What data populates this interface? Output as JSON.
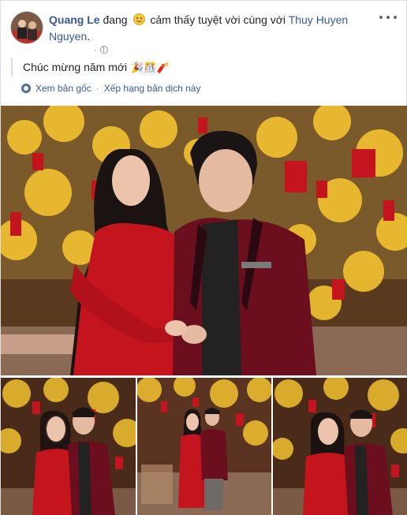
{
  "post": {
    "author": "Quang Le",
    "feeling_prefix": "đang",
    "feeling_icon": "smile-emoji",
    "feeling_text": "cảm thấy tuyệt vời cùng với",
    "tagged_user": "Thuy Huyen Nguyen",
    "tagged_suffix": ".",
    "timestamp": "·",
    "privacy_icon": "globe-icon",
    "status_text": "Chúc mừng năm mới",
    "status_emojis": "🎉🎊🧨",
    "see_original": "Xem bản gốc",
    "separator": "·",
    "rate_translation": "Xếp hạng bản dịch này"
  },
  "photos": [
    {
      "label": "photo-main",
      "icon": "photo-couple"
    },
    {
      "label": "photo-thumb-1",
      "icon": "photo-couple"
    },
    {
      "label": "photo-thumb-2",
      "icon": "photo-couple"
    },
    {
      "label": "photo-thumb-3",
      "icon": "photo-couple"
    }
  ],
  "colors": {
    "link": "#365899",
    "text": "#1d2129",
    "meta": "#90949c",
    "red_dress": "#c4141e",
    "velvet_jacket": "#6b0f1e",
    "blossom_yellow": "#f2c230"
  }
}
